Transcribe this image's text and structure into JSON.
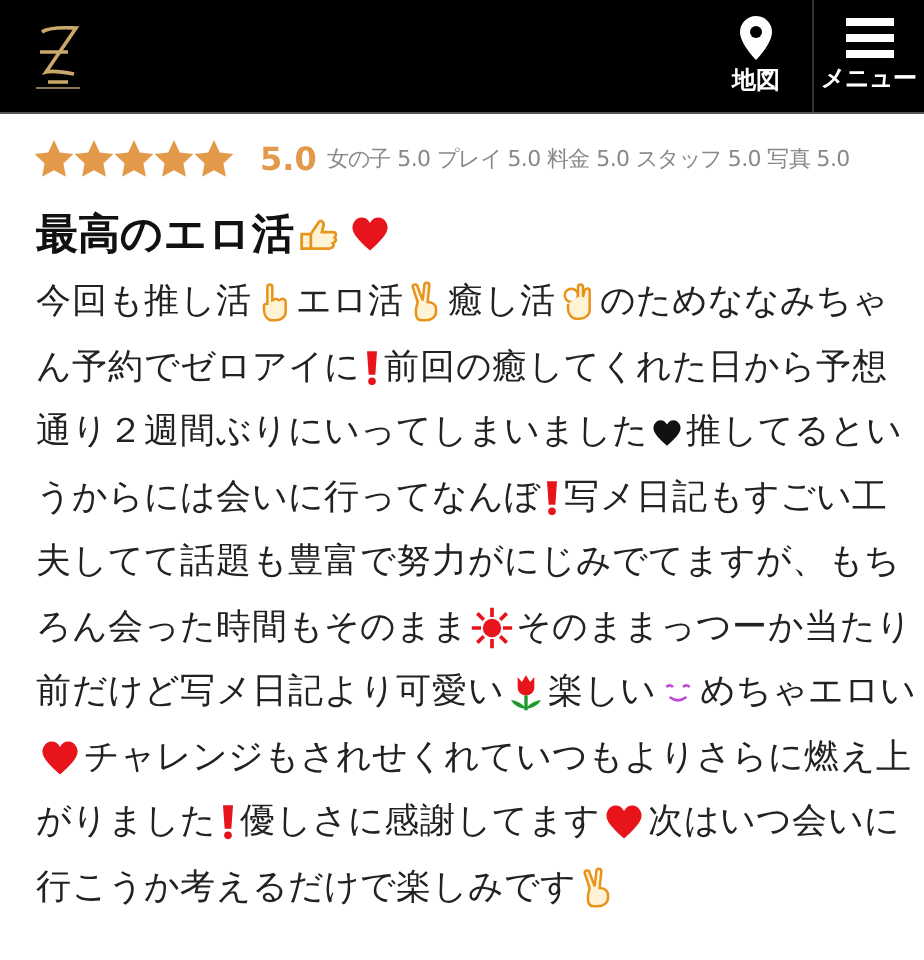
{
  "header": {
    "nav": [
      {
        "kind": "map",
        "label": "地図"
      },
      {
        "kind": "menu",
        "label": "メニュー"
      }
    ]
  },
  "rating": {
    "stars": 5,
    "score": "5.0",
    "categories": [
      {
        "label": "女の子",
        "score": "5.0"
      },
      {
        "label": "プレイ",
        "score": "5.0"
      },
      {
        "label": "料金",
        "score": "5.0"
      },
      {
        "label": "スタッフ",
        "score": "5.0"
      },
      {
        "label": "写真",
        "score": "5.0"
      }
    ]
  },
  "review": {
    "title": [
      {
        "kind": "text",
        "text": "最高のエロ活"
      },
      {
        "kind": "thumbs"
      },
      {
        "kind": "heart"
      }
    ],
    "lines": [
      [
        {
          "kind": "text",
          "text": "今回も推し活"
        },
        {
          "kind": "point"
        },
        {
          "kind": "text",
          "text": "エロ活"
        },
        {
          "kind": "peace"
        },
        {
          "kind": "text",
          "text": "癒し活"
        },
        {
          "kind": "ok"
        },
        {
          "kind": "text",
          "text": "のためななみちゃ"
        }
      ],
      [
        {
          "kind": "text",
          "text": "ん予約でゼロアイに"
        },
        {
          "kind": "exclaim"
        },
        {
          "kind": "text",
          "text": "前回の癒してくれた日から予想"
        }
      ],
      [
        {
          "kind": "text",
          "text": "通り２週間ぶりにいってしまいました"
        },
        {
          "kind": "smallheart"
        },
        {
          "kind": "text",
          "text": "推してるとい"
        }
      ],
      [
        {
          "kind": "text",
          "text": "うからには会いに行ってなんぼ"
        },
        {
          "kind": "exclaim"
        },
        {
          "kind": "text",
          "text": "写メ日記もすごい工"
        }
      ],
      [
        {
          "kind": "text",
          "text": "夫してて話題も豊富で努力がにじみでてますが、もち"
        }
      ],
      [
        {
          "kind": "text",
          "text": "ろん会った時間もそのまま"
        },
        {
          "kind": "sun"
        },
        {
          "kind": "text",
          "text": "そのままっつーか当たり"
        }
      ],
      [
        {
          "kind": "text",
          "text": "前だけど写メ日記より可愛い"
        },
        {
          "kind": "tulip"
        },
        {
          "kind": "text",
          "text": "楽しい"
        },
        {
          "kind": "smile"
        },
        {
          "kind": "text",
          "text": "めちゃエロい"
        }
      ],
      [
        {
          "kind": "heart"
        },
        {
          "kind": "text",
          "text": "チャレンジもされせくれていつもよりさらに燃え上"
        }
      ],
      [
        {
          "kind": "text",
          "text": "がりました"
        },
        {
          "kind": "exclaim"
        },
        {
          "kind": "text",
          "text": "優しさに感謝してます"
        },
        {
          "kind": "heart"
        },
        {
          "kind": "text",
          "text": "次はいつ会いに"
        }
      ],
      [
        {
          "kind": "text",
          "text": "行こうか考えるだけで楽しみです"
        },
        {
          "kind": "peace"
        }
      ]
    ]
  }
}
